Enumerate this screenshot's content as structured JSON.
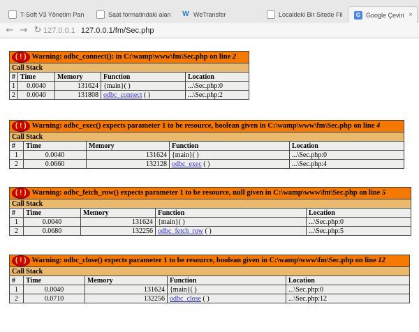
{
  "browser": {
    "tabs": [
      {
        "title": "T-Soft V3 Yönetim Pan",
        "icon": "page-icon",
        "active": false
      },
      {
        "title": "Saat formatindaki alan",
        "icon": "page-icon",
        "active": false
      },
      {
        "title": "WeTransfer",
        "icon": "wetransfer-icon",
        "active": false
      },
      {
        "title": "Localdeki Bir Sitede Fil",
        "icon": "page-icon",
        "active": false
      },
      {
        "title": "Google Çeviri",
        "icon": "google-translate-icon",
        "active": true
      }
    ],
    "close_glyph": "×",
    "host": "127.0.0.1",
    "url": "127.0.0.1/fm/Sec.php",
    "wetransfer_glyph": "W",
    "translate_glyph": "G"
  },
  "labels": {
    "bang": "( ! )",
    "call_stack": "Call Stack",
    "cols": [
      "#",
      "Time",
      "Memory",
      "Function",
      "Location"
    ]
  },
  "errors": [
    {
      "message": "Warning: odbc_connect(): in C:\\wamp\\www\\fm\\Sec.php on line ",
      "line": "2",
      "rows": [
        {
          "n": "1",
          "time": "0.0040",
          "memory": "131624",
          "function": "{main}( )",
          "func_link": "",
          "location": "...\\Sec.php:0"
        },
        {
          "n": "2",
          "time": "0.0040",
          "memory": "131808",
          "function": "( )",
          "func_link": "odbc_connect",
          "location": "...\\Sec.php:2"
        }
      ]
    },
    {
      "message": "Warning: odbc_exec() expects parameter 1 to be resource, boolean given in C:\\wamp\\www\\fm\\Sec.php on line ",
      "line": "4",
      "rows": [
        {
          "n": "1",
          "time": "0.0040",
          "memory": "131624",
          "function": "{main}( )",
          "func_link": "",
          "location": "...\\Sec.php:0"
        },
        {
          "n": "2",
          "time": "0.0660",
          "memory": "132128",
          "function": "( )",
          "func_link": "odbc_exec",
          "location": "...\\Sec.php:4"
        }
      ]
    },
    {
      "message": "Warning: odbc_fetch_row() expects parameter 1 to be resource, null given in C:\\wamp\\www\\fm\\Sec.php on line ",
      "line": "5",
      "rows": [
        {
          "n": "1",
          "time": "0.0040",
          "memory": "131624",
          "function": "{main}( )",
          "func_link": "",
          "location": "...\\Sec.php:0"
        },
        {
          "n": "2",
          "time": "0.0680",
          "memory": "132256",
          "function": "( )",
          "func_link": "odbc_fetch_row",
          "location": "...\\Sec.php:5"
        }
      ]
    },
    {
      "message": "Warning: odbc_close() expects parameter 1 to be resource, boolean given in C:\\wamp\\www\\fm\\Sec.php on line ",
      "line": "12",
      "rows": [
        {
          "n": "1",
          "time": "0.0040",
          "memory": "131624",
          "function": "{main}( )",
          "func_link": "",
          "location": "...\\Sec.php:0"
        },
        {
          "n": "2",
          "time": "0.0710",
          "memory": "132256",
          "function": "( )",
          "func_link": "odbc_close",
          "location": "...\\Sec.php:12"
        }
      ]
    }
  ],
  "colors": {
    "warning_bg": "#f57900",
    "callstack_bg": "#e9b96e",
    "cell_bg": "#eeeeec",
    "bang_bg": "#cc0000",
    "bang_fg": "#fce94f",
    "link": "#3333cc"
  }
}
